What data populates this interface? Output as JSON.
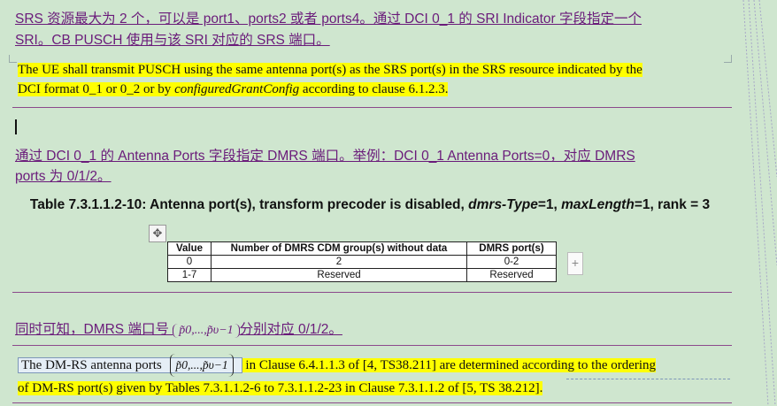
{
  "para1": {
    "line1": "SRS 资源最大为 2 个，可以是 port1、ports2 或者 ports4。通过 DCI 0_1 的 SRI Indicator 字段指定一个",
    "line2": "SRI。CB PUSCH 使用与该 SRI 对应的 SRS 端口。"
  },
  "quote1": {
    "line1": "The UE shall transmit PUSCH using the same antenna port(s) as the SRS port(s) in the SRS resource indicated by the",
    "line2_pre": "DCI format 0_1 or 0_2 or by ",
    "line2_italic": "configuredGrantConfig",
    "line2_post": " according to clause 6.1.2.3."
  },
  "para3": {
    "line1": "通过 DCI 0_1 的 Antenna Ports 字段指定 DMRS 端口。举例：DCI 0_1 Antenna Ports=0，对应 DMRS",
    "line2": "ports 为 0/1/2。"
  },
  "table_caption": {
    "pre": "Table 7.3.1.1.2-10: Antenna port(s), transform precoder is disabled, ",
    "it1": "dmrs-Type",
    "mid": "=1, ",
    "it2": "maxLength",
    "post": "=1, rank = 3"
  },
  "table": {
    "headers": [
      "Value",
      "Number of DMRS CDM group(s) without data",
      "DMRS port(s)"
    ],
    "rows": [
      [
        "0",
        "2",
        "0-2"
      ],
      [
        "1-7",
        "Reserved",
        "Reserved"
      ]
    ]
  },
  "para4": {
    "pre": "同时可知，DMRS 端口号 ",
    "math": "p̃0,...,p̃υ−1",
    "post": "分别对应 0/1/2。"
  },
  "quote2": {
    "pre": "The DM-RS antenna ports ",
    "math": "p̃0,...,p̃υ−1",
    "line1_post": " in Clause 6.4.1.1.3 of [4, TS38.211] are determined according to the ordering",
    "line2": "of DM-RS port(s) given by Tables 7.3.1.1.2-6 to 7.3.1.1.2-23 in Clause 7.3.1.1.2 of [5, TS 38.212]."
  },
  "icons": {
    "move": "move-icon",
    "plus": "plus-icon"
  },
  "colors": {
    "page_bg": "#cfe6cf",
    "tracked_text": "#6a1b7a",
    "highlight": "#ffff00"
  }
}
